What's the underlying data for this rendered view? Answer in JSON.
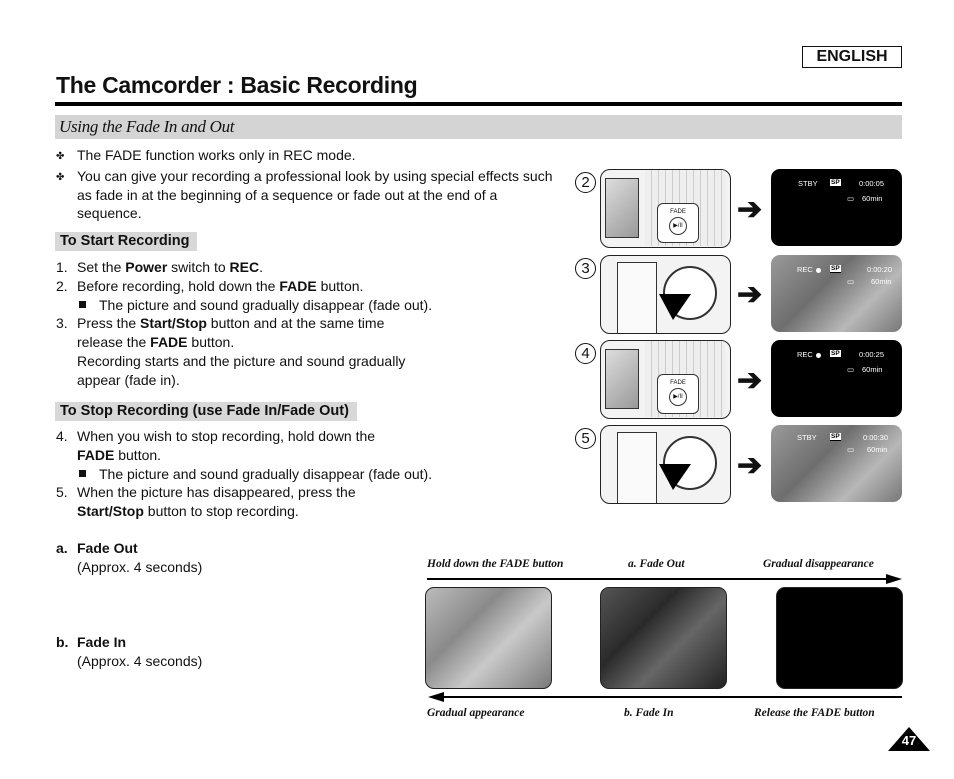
{
  "header": {
    "language": "ENGLISH",
    "title": "The Camcorder : Basic Recording",
    "section": "Using the Fade In and Out"
  },
  "intro_bullets": [
    "The FADE function works only in REC mode.",
    "You can give your recording a professional look by using special effects such as fade in at the beginning of a sequence or fade out at the end of a sequence."
  ],
  "start_recording": {
    "heading": "To Start Recording",
    "steps": [
      {
        "num": "1.",
        "parts": [
          "Set the ",
          "Power",
          " switch to ",
          "REC",
          "."
        ]
      },
      {
        "num": "2.",
        "parts": [
          "Before recording, hold down the ",
          "FADE",
          " button."
        ],
        "note": "The picture and sound gradually disappear (fade out)."
      },
      {
        "num": "3.",
        "parts": [
          "Press the ",
          "Start/Stop",
          " button and at the same time release the ",
          "FADE",
          " button."
        ],
        "extra": "Recording starts and the picture and sound gradually appear (fade in)."
      }
    ]
  },
  "stop_recording": {
    "heading": "To Stop Recording (use Fade In/Fade Out)",
    "steps": [
      {
        "num": "4.",
        "parts": [
          "When you wish to stop recording, hold down the ",
          "FADE",
          " button."
        ],
        "note": "The picture and sound gradually disappear (fade out)."
      },
      {
        "num": "5.",
        "parts": [
          "When the picture has disappeared, press the ",
          "Start/Stop",
          " button to stop recording."
        ]
      }
    ]
  },
  "fade_notes": [
    {
      "label": "a.",
      "title": "Fade Out",
      "duration": "(Approx. 4 seconds)"
    },
    {
      "label": "b.",
      "title": "Fade In",
      "duration": "(Approx. 4 seconds)"
    }
  ],
  "illustrations": [
    {
      "num": "2",
      "fade_label": "FADE",
      "button_icon": "play-pause",
      "mode": "STBY",
      "sp": "SP",
      "time": "0:00:05",
      "tape": "60min",
      "screen": "black"
    },
    {
      "num": "3",
      "mode": "REC",
      "sp": "SP",
      "time": "0:00:20",
      "tape": "60min",
      "screen": "photo"
    },
    {
      "num": "4",
      "fade_label": "FADE",
      "button_icon": "play-pause",
      "mode": "REC",
      "sp": "SP",
      "time": "0:00:25",
      "tape": "60min",
      "screen": "black"
    },
    {
      "num": "5",
      "mode": "STBY",
      "sp": "SP",
      "time": "0:00:30",
      "tape": "60min",
      "screen": "photo"
    }
  ],
  "flow": {
    "top": [
      "Hold down the FADE button",
      "a. Fade Out",
      "Gradual disappearance"
    ],
    "bottom": [
      "Gradual appearance",
      "b. Fade In",
      "Release the FADE button"
    ]
  },
  "page_number": "47"
}
